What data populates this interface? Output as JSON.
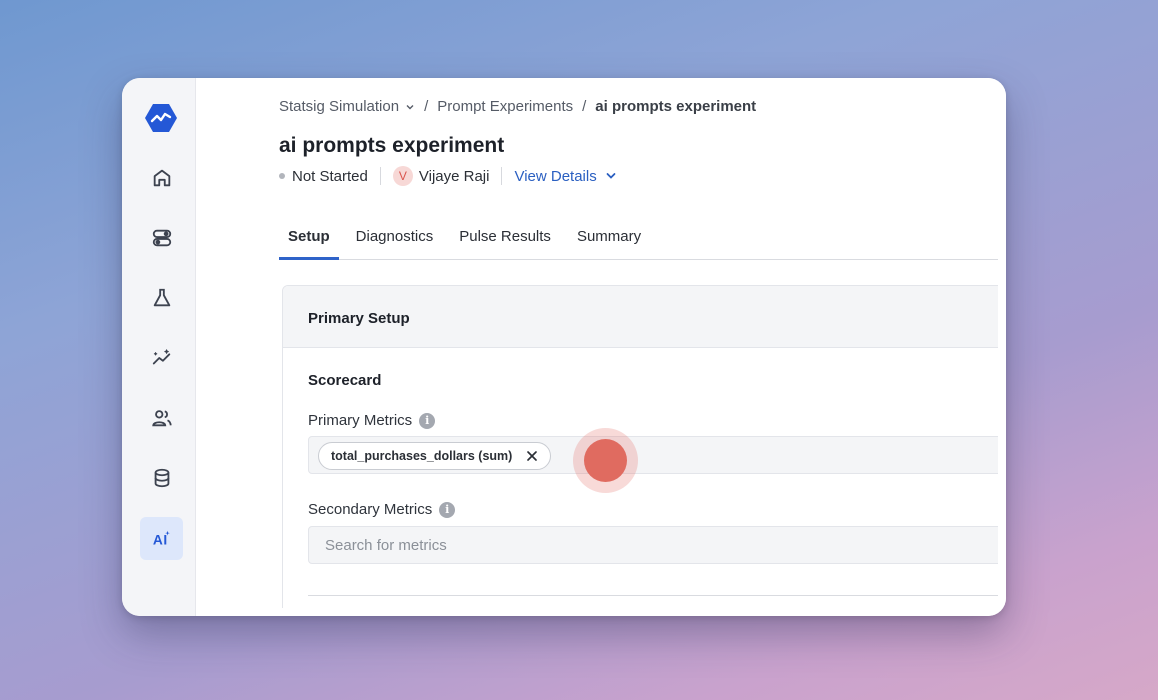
{
  "breadcrumb": {
    "project": "Statsig Simulation",
    "section": "Prompt Experiments",
    "current": "ai prompts experiment"
  },
  "experiment": {
    "title": "ai prompts experiment",
    "status": "Not Started",
    "owner_initial": "V",
    "owner_name": "Vijaye Raji",
    "view_details": "View Details"
  },
  "tabs": [
    {
      "label": "Setup",
      "active": true
    },
    {
      "label": "Diagnostics",
      "active": false
    },
    {
      "label": "Pulse Results",
      "active": false
    },
    {
      "label": "Summary",
      "active": false
    }
  ],
  "setup": {
    "card_title": "Primary Setup",
    "scorecard_title": "Scorecard",
    "primary_metrics_label": "Primary Metrics",
    "primary_metrics": [
      "total_purchases_dollars (sum)"
    ],
    "secondary_metrics_label": "Secondary Metrics",
    "secondary_search_placeholder": "Search for metrics"
  },
  "sidebar": {
    "items": [
      {
        "icon": "home-icon"
      },
      {
        "icon": "toggle-icon"
      },
      {
        "icon": "flask-icon"
      },
      {
        "icon": "analytics-icon"
      },
      {
        "icon": "users-icon"
      },
      {
        "icon": "database-icon"
      },
      {
        "icon": "ai-icon",
        "active": true
      }
    ]
  },
  "colors": {
    "accent": "#2f63c9",
    "link": "#2a5fc1",
    "cursor": "#e06b60"
  }
}
